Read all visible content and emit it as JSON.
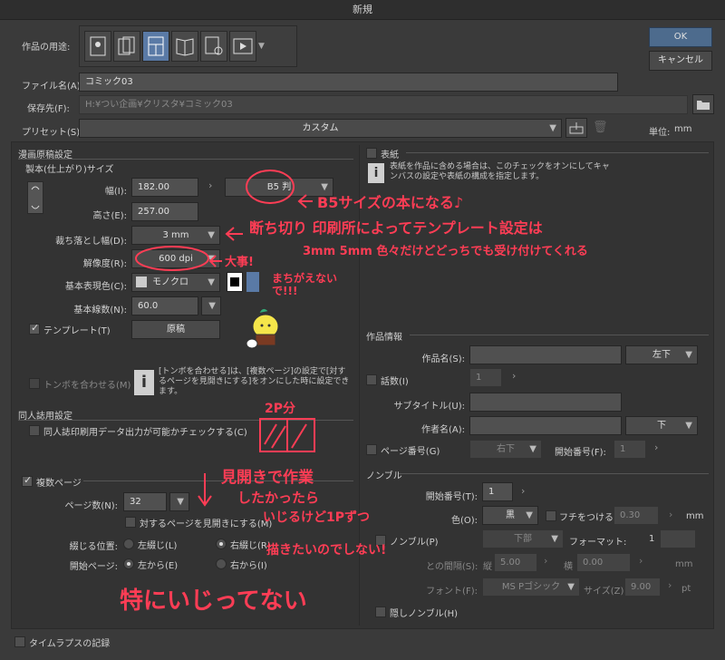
{
  "window": {
    "title": "新規"
  },
  "header": {
    "usage_label": "作品の用途:",
    "filename_label": "ファイル名(A):",
    "filename_value": "コミック03",
    "save_label": "保存先(F):",
    "save_path": "H:¥つい企画¥クリスタ¥コミック03",
    "preset_label": "プリセット(S):",
    "preset_value": "カスタム",
    "unit_label": "単位:",
    "unit_value": "mm",
    "ok_label": "OK",
    "cancel_label": "キャンセル"
  },
  "manga": {
    "section_title": "漫画原稿設定",
    "size_title": "製本(仕上がり)サイズ",
    "width_label": "幅(I):",
    "width_value": "182.00",
    "height_label": "高さ(E):",
    "height_value": "257.00",
    "paper_size": "B5 判",
    "bleed_label": "裁ち落とし幅(D):",
    "bleed_value": "3 mm",
    "res_label": "解像度(R):",
    "res_value": "600 dpi",
    "color_label": "基本表現色(C):",
    "color_value": "モノクロ",
    "lines_label": "基本線数(N):",
    "lines_value": "60.0",
    "template_label": "テンプレート(T)",
    "template_btn": "原稿",
    "tombo_label": "トンボを合わせる(M)",
    "tombo_info": "[トンボを合わせる]は、[複数ページ]の設定で[対するページを見開きにする]をオンにした時に設定できます。"
  },
  "doujin": {
    "title": "同人誌用設定",
    "check_label": "同人誌印刷用データ出力が可能かチェックする(C)"
  },
  "pages": {
    "multi_label": "複数ページ",
    "count_label": "ページ数(N):",
    "count_value": "32",
    "spread_label": "対するページを見開きにする(M)",
    "binding_label": "綴じる位置:",
    "left_bind": "左綴じ(L)",
    "right_bind": "右綴じ(R)",
    "start_label": "開始ページ:",
    "from_left": "左から(E)",
    "from_right": "右から(I)"
  },
  "timelapse": {
    "label": "タイムラプスの記録"
  },
  "cover": {
    "label": "表紙",
    "info": "表紙を作品に含める場合は、このチェックをオンにしてキャンバスの設定や表紙の構成を指定します。"
  },
  "work_info": {
    "title": "作品情報",
    "name_label": "作品名(S):",
    "name_pos": "左下",
    "episode_label": "話数(I)",
    "episode_value": "1",
    "subtitle_label": "サブタイトル(U):",
    "author_label": "作者名(A):",
    "author_pos": "下",
    "pagenum_label": "ページ番号(G)",
    "pagenum_pos": "右下",
    "pagenum_start_label": "開始番号(F):",
    "pagenum_start_value": "1"
  },
  "nombre": {
    "title": "ノンブル",
    "start_label": "開始番号(T):",
    "start_value": "1",
    "color_label": "色(O):",
    "color_value": "黒",
    "edge_label": "フチをつける(E)",
    "edge_value": "0.30",
    "edge_unit": "mm",
    "nombre_label": "ノンブル(P)",
    "pos_value": "下部",
    "format_label": "フォーマット:",
    "format_value": "1",
    "gap_label": "との間隔(S):",
    "gap_v_label": "縦",
    "gap_v_value": "5.00",
    "gap_h_label": "横",
    "gap_h_value": "0.00",
    "gap_unit": "mm",
    "font_label": "フォント(F):",
    "font_value": "MS Pゴシック",
    "size_label": "サイズ(Z):",
    "size_value": "9.00",
    "size_unit": "pt",
    "hidden_label": "隠しノンブル(H)"
  },
  "annotations": {
    "b5": "B5サイズの本になる♪",
    "bleed": "断ち切り 印刷所によってテンプレート設定は",
    "bleed2": "3mm 5mm 色々だけどどっちでも受け付けてくれる",
    "dpi": "大事!",
    "dpi2": "まちがえないで!!!",
    "twop": "2P分",
    "spread1": "見開きで作業",
    "spread2": "したかったら",
    "spread3": "いじるけど1Pずつ",
    "spread4": "描きたいのでしない!",
    "notouch": "特にいじってない"
  },
  "colors": {
    "accent": "#5a7aa6",
    "annotation": "#ff3d55"
  }
}
